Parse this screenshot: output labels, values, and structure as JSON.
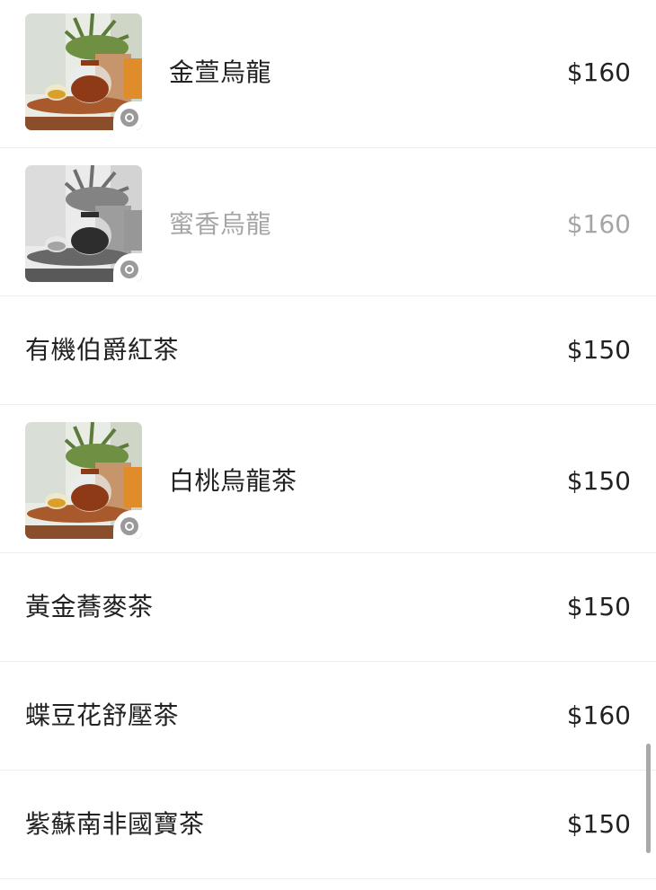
{
  "menu": {
    "items": [
      {
        "name": "金萱烏龍",
        "price": "$160",
        "has_image": true,
        "sold_out": false,
        "image_icon": "teapot-photo"
      },
      {
        "name": "蜜香烏龍",
        "price": "$160",
        "has_image": true,
        "sold_out": true,
        "image_icon": "teapot-photo"
      },
      {
        "name": "有機伯爵紅茶",
        "price": "$150",
        "has_image": false,
        "sold_out": false
      },
      {
        "name": "白桃烏龍茶",
        "price": "$150",
        "has_image": true,
        "sold_out": false,
        "image_icon": "teapot-photo"
      },
      {
        "name": "黃金蕎麥茶",
        "price": "$150",
        "has_image": false,
        "sold_out": false
      },
      {
        "name": "蝶豆花舒壓茶",
        "price": "$160",
        "has_image": false,
        "sold_out": false
      },
      {
        "name": "紫蘇南非國寶茶",
        "price": "$150",
        "has_image": false,
        "sold_out": false
      }
    ]
  },
  "colors": {
    "text": "#222222",
    "sold_out_text": "#a6a6a6",
    "divider": "#eeeeee",
    "scrollbar": "#a9a9a9"
  }
}
